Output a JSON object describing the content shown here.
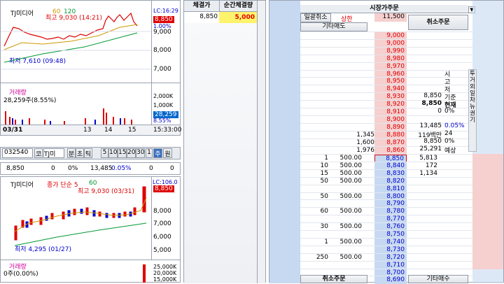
{
  "chart1": {
    "title": "TJ미디어",
    "ma": "60",
    "ma2": "120",
    "lc": "LC:16:29",
    "high": "최고 9,030 (14:21)",
    "low": "최저 7,610 (09:48)",
    "price": "8,850",
    "pct": "1.00%",
    "yticks": [
      "9,000",
      "8,000",
      "7,000"
    ],
    "vol_title": "거래량",
    "vol_info": "28,259주(8.55%)",
    "vol_ticks": [
      "2,000K",
      "1,000K"
    ],
    "vol_last": "28,259",
    "vol_pct": "8.55%",
    "date": "03/31",
    "xticks": [
      "13",
      "14",
      "15"
    ],
    "time": "15:33:00"
  },
  "toolbar": {
    "code": "032540",
    "b1": "코",
    "b2": "TJ미",
    "b3": "분",
    "b4": "초",
    "b5": "틱",
    "nums": [
      "5",
      "10",
      "15",
      "20",
      "30"
    ],
    "b6": "1",
    "b7": "주",
    "b8": "원"
  },
  "quote": {
    "price": "8,850",
    "change": "0",
    "pct": "0%",
    "volume": "13,485",
    "vpct": "0.05%",
    "v2": "0",
    "v3": "0"
  },
  "chart2": {
    "title": "TJ미디어",
    "ma": "종가 단순 5",
    "ma2": "60",
    "lc": "LC:106.0",
    "high": "최고 9,030 (03/31)",
    "low": "최저 4,295 (01/27)",
    "price": "8,850",
    "yticks": [
      "8,000",
      "7,000",
      "6,000",
      "5,000"
    ],
    "vol_title": "거래량",
    "vol_info": "0주(0.00%)",
    "vol_ticks": [
      "25,000K",
      "20,000K",
      "15,000K"
    ]
  },
  "trades": {
    "h1": "체결가",
    "h2": "순간체결량",
    "rows": [
      {
        "price": "8,850",
        "qty": "5,000"
      }
    ]
  },
  "order": {
    "title": "시장가주문",
    "b_cancel_all": "일괄취소",
    "upper": "상한",
    "upper_price": "11,500",
    "b_other_sell": "기타매도",
    "cancel_order": "취소주문",
    "b_cancel_bottom": "취소주문",
    "b_other_buy": "기타매수",
    "ask": [
      {
        "p": "9,000",
        "q": ""
      },
      {
        "p": "9,000",
        "q": ""
      },
      {
        "p": "8,990",
        "q": ""
      },
      {
        "p": "8,980",
        "q": ""
      },
      {
        "p": "8,970",
        "q": ""
      },
      {
        "p": "8,960",
        "q": ""
      },
      {
        "p": "8,950",
        "q": ""
      },
      {
        "p": "8,940",
        "q": ""
      },
      {
        "p": "8,930",
        "q": ""
      },
      {
        "p": "8,920",
        "q": ""
      },
      {
        "p": "8,910",
        "q": ""
      },
      {
        "p": "8,900",
        "q": ""
      },
      {
        "p": "8,890",
        "q": ""
      },
      {
        "p": "8,880",
        "q": "1,345"
      },
      {
        "p": "8,870",
        "q": "1,600"
      },
      {
        "p": "8,860",
        "q": "1,976"
      }
    ],
    "bid": [
      {
        "p": "8,850",
        "n": "1",
        "q": "500.00",
        "r": "5,813"
      },
      {
        "p": "8,840",
        "n": "10",
        "q": "500.00",
        "r": "172"
      },
      {
        "p": "8,830",
        "n": "15",
        "q": "500.00",
        "r": "1,134"
      },
      {
        "p": "8,820",
        "n": "50",
        "q": "500.00",
        "r": ""
      },
      {
        "p": "8,810",
        "n": "",
        "q": "",
        "r": ""
      },
      {
        "p": "8,800",
        "n": "50",
        "q": "500.00",
        "r": ""
      },
      {
        "p": "8,790",
        "n": "",
        "q": "",
        "r": ""
      },
      {
        "p": "8,780",
        "n": "60",
        "q": "500.00",
        "r": ""
      },
      {
        "p": "8,770",
        "n": "",
        "q": "",
        "r": ""
      },
      {
        "p": "8,760",
        "n": "30",
        "q": "500.00",
        "r": ""
      },
      {
        "p": "8,750",
        "n": "",
        "q": "",
        "r": ""
      },
      {
        "p": "8,740",
        "n": "1",
        "q": "500.00",
        "r": ""
      },
      {
        "p": "8,730",
        "n": "",
        "q": "",
        "r": ""
      },
      {
        "p": "8,720",
        "n": "250",
        "q": "500.00",
        "r": ""
      },
      {
        "p": "8,710",
        "n": "",
        "q": "",
        "r": ""
      },
      {
        "p": "8,700",
        "n": "",
        "q": "",
        "r": ""
      },
      {
        "p": "8,690",
        "n": "",
        "q": "",
        "r": ""
      }
    ],
    "info": [
      {
        "l": "시",
        "v": ""
      },
      {
        "l": "고",
        "v": ""
      },
      {
        "l": "저",
        "v": ""
      },
      {
        "l": "기준",
        "v": "8,850"
      },
      {
        "l": "현재",
        "v": "8,850"
      },
      {
        "l": "0%",
        "v": "0"
      },
      {
        "l": "",
        "v": ""
      },
      {
        "l": "0.05%",
        "v": "13,485"
      },
      {
        "l": "24",
        "v": "119백만"
      },
      {
        "l": "0%",
        "v": "8,850"
      },
      {
        "l": "예상",
        "v": "25,291"
      }
    ],
    "side": "투거외일차뉴권기"
  }
}
